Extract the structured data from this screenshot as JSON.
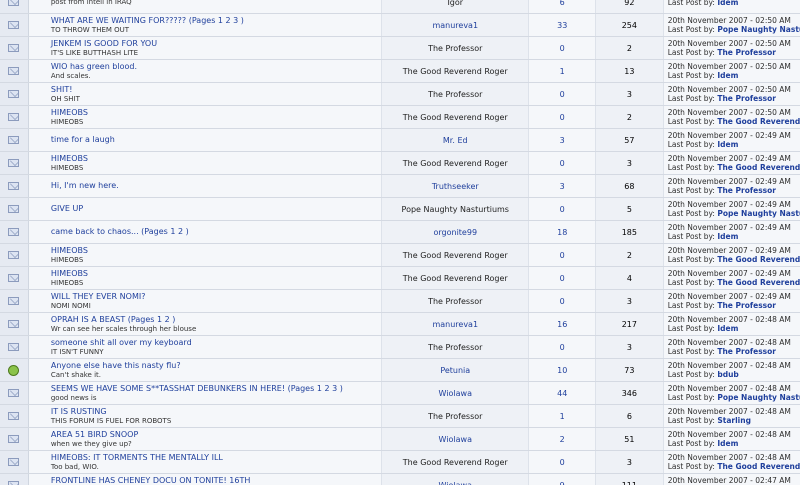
{
  "topics": [
    {
      "title": "",
      "desc": "post from intell in IRAQ",
      "poster": "Igor",
      "replies": "6",
      "views": "92",
      "date": "",
      "lastby": "Idem",
      "icon": "envelope-icon"
    },
    {
      "title": "WHAT ARE WE WAITING FOR????? (Pages 1 2 3 )",
      "desc": "TO THROW THEM OUT",
      "poster": "manureva1",
      "replies": "33",
      "views": "254",
      "date": "20th November 2007 - 02:50 AM",
      "lastby": "Pope Naughty Nasturtiums",
      "icon": "envelope-icon"
    },
    {
      "title": "JENKEM IS GOOD FOR YOU",
      "desc": "IT'S LIKE BUTTHASH LITE",
      "poster": "The Professor",
      "replies": "0",
      "views": "2",
      "date": "20th November 2007 - 02:50 AM",
      "lastby": "The Professor",
      "icon": "envelope-icon"
    },
    {
      "title": "WIO has green blood.",
      "desc": "And scales.",
      "poster": "The Good Reverend Roger",
      "replies": "1",
      "views": "13",
      "date": "20th November 2007 - 02:50 AM",
      "lastby": "Idem",
      "icon": "envelope-icon"
    },
    {
      "title": "SHIT!",
      "desc": "OH SHIT",
      "poster": "The Professor",
      "replies": "0",
      "views": "3",
      "date": "20th November 2007 - 02:50 AM",
      "lastby": "The Professor",
      "icon": "envelope-icon"
    },
    {
      "title": "HIMEOBS",
      "desc": "HIMEOBS",
      "poster": "The Good Reverend Roger",
      "replies": "0",
      "views": "2",
      "date": "20th November 2007 - 02:50 AM",
      "lastby": "The Good Reverend Roger",
      "icon": "envelope-icon"
    },
    {
      "title": "time for a laugh",
      "desc": "",
      "poster": "Mr. Ed",
      "replies": "3",
      "views": "57",
      "date": "20th November 2007 - 02:49 AM",
      "lastby": "Idem",
      "icon": "envelope-icon"
    },
    {
      "title": "HIMEOBS",
      "desc": "HIMEOBS",
      "poster": "The Good Reverend Roger",
      "replies": "0",
      "views": "3",
      "date": "20th November 2007 - 02:49 AM",
      "lastby": "The Good Reverend Roger",
      "icon": "envelope-icon"
    },
    {
      "title": "Hi, I'm new here.",
      "desc": "",
      "poster": "Truthseeker",
      "replies": "3",
      "views": "68",
      "date": "20th November 2007 - 02:49 AM",
      "lastby": "The Professor",
      "icon": "envelope-icon"
    },
    {
      "title": "GIVE UP",
      "desc": "",
      "poster": "Pope Naughty Nasturtiums",
      "replies": "0",
      "views": "5",
      "date": "20th November 2007 - 02:49 AM",
      "lastby": "Pope Naughty Nasturtiums",
      "icon": "envelope-icon"
    },
    {
      "title": "came back to chaos... (Pages 1 2 )",
      "desc": "",
      "poster": "orgonite99",
      "replies": "18",
      "views": "185",
      "date": "20th November 2007 - 02:49 AM",
      "lastby": "Idem",
      "icon": "envelope-icon"
    },
    {
      "title": "HIMEOBS",
      "desc": "HIMEOBS",
      "poster": "The Good Reverend Roger",
      "replies": "0",
      "views": "2",
      "date": "20th November 2007 - 02:49 AM",
      "lastby": "The Good Reverend Roger",
      "icon": "envelope-icon"
    },
    {
      "title": "HIMEOBS",
      "desc": "HIMEOBS",
      "poster": "The Good Reverend Roger",
      "replies": "0",
      "views": "4",
      "date": "20th November 2007 - 02:49 AM",
      "lastby": "The Good Reverend Roger",
      "icon": "envelope-icon"
    },
    {
      "title": "WILL THEY EVER NOMI?",
      "desc": "NOMI NOMI",
      "poster": "The Professor",
      "replies": "0",
      "views": "3",
      "date": "20th November 2007 - 02:49 AM",
      "lastby": "The Professor",
      "icon": "envelope-icon"
    },
    {
      "title": "OPRAH IS A BEAST (Pages 1 2 )",
      "desc": "Wr can see her scales through her blouse",
      "poster": "manureva1",
      "replies": "16",
      "views": "217",
      "date": "20th November 2007 - 02:48 AM",
      "lastby": "Idem",
      "icon": "envelope-icon"
    },
    {
      "title": "someone shit all over my keyboard",
      "desc": "IT ISN'T FUNNY",
      "poster": "The Professor",
      "replies": "0",
      "views": "3",
      "date": "20th November 2007 - 02:48 AM",
      "lastby": "The Professor",
      "icon": "envelope-icon"
    },
    {
      "title": "Anyone else have this nasty flu?",
      "desc": "Can't shake it.",
      "poster": "Petunia",
      "replies": "10",
      "views": "73",
      "date": "20th November 2007 - 02:48 AM",
      "lastby": "bdub",
      "icon": "sick-face-icon"
    },
    {
      "title": "SEEMS WE HAVE SOME S**TASSHAT DEBUNKERS IN HERE! (Pages 1 2 3 )",
      "desc": "good news is",
      "poster": "Wiolawa",
      "replies": "44",
      "views": "346",
      "date": "20th November 2007 - 02:48 AM",
      "lastby": "Pope Naughty Nasturtiums",
      "icon": "envelope-icon"
    },
    {
      "title": "IT IS RUSTING",
      "desc": "THIS FORUM IS FUEL FOR ROBOTS",
      "poster": "The Professor",
      "replies": "1",
      "views": "6",
      "date": "20th November 2007 - 02:48 AM",
      "lastby": "Starling",
      "icon": "envelope-icon"
    },
    {
      "title": "AREA 51 BIRD SNOOP",
      "desc": "when we they give up?",
      "poster": "Wiolawa",
      "replies": "2",
      "views": "51",
      "date": "20th November 2007 - 02:48 AM",
      "lastby": "Idem",
      "icon": "envelope-icon"
    },
    {
      "title": "HIMEOBS: IT TORMENTS THE MENTALLY ILL",
      "desc": "Too bad, WIO.",
      "poster": "The Good Reverend Roger",
      "replies": "0",
      "views": "3",
      "date": "20th November 2007 - 02:48 AM",
      "lastby": "The Good Reverend Roger",
      "icon": "envelope-icon"
    },
    {
      "title": "FRONTLINE HAS CHENEY DOCU ON TONITE! 16TH",
      "desc": "idont think they like him either",
      "poster": "Wiolawa",
      "replies": "9",
      "views": "111",
      "date": "20th November 2007 - 02:47 AM",
      "lastby": "Idem",
      "icon": "envelope-icon"
    }
  ],
  "labels": {
    "last_post_by": "Last Post by:"
  },
  "colors": {
    "link": "#1f3f9c",
    "row_light": "#f5f7fa",
    "row_mid": "#eef1f6",
    "row_dark": "#e6eaf2"
  }
}
